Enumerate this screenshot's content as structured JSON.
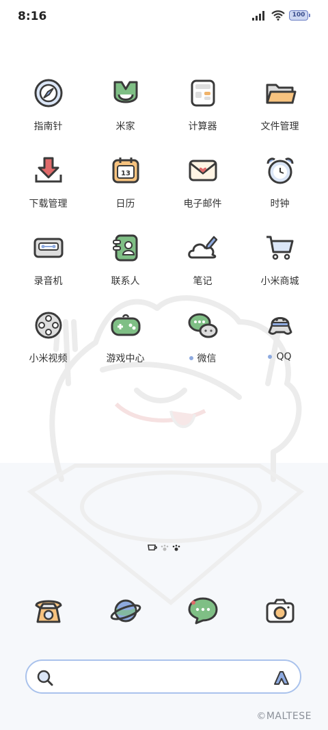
{
  "status_bar": {
    "time": "8:16",
    "battery": "100"
  },
  "apps": [
    {
      "label": "指南针",
      "icon": "compass-icon"
    },
    {
      "label": "米家",
      "icon": "mijia-icon"
    },
    {
      "label": "计算器",
      "icon": "calculator-icon"
    },
    {
      "label": "文件管理",
      "icon": "folder-icon"
    },
    {
      "label": "下载管理",
      "icon": "download-icon"
    },
    {
      "label": "日历",
      "icon": "calendar-icon",
      "day": "13"
    },
    {
      "label": "电子邮件",
      "icon": "mail-icon"
    },
    {
      "label": "时钟",
      "icon": "alarm-clock-icon"
    },
    {
      "label": "录音机",
      "icon": "recorder-icon"
    },
    {
      "label": "联系人",
      "icon": "contacts-icon"
    },
    {
      "label": "笔记",
      "icon": "notes-icon"
    },
    {
      "label": "小米商城",
      "icon": "cart-icon"
    },
    {
      "label": "小米视频",
      "icon": "film-reel-icon"
    },
    {
      "label": "游戏中心",
      "icon": "gamepad-icon"
    },
    {
      "label": "微信",
      "icon": "wechat-icon"
    },
    {
      "label": "QQ",
      "icon": "qq-penguin-icon"
    }
  ],
  "dock": [
    {
      "icon": "phone-icon"
    },
    {
      "icon": "browser-planet-icon"
    },
    {
      "icon": "messages-icon"
    },
    {
      "icon": "camera-icon"
    }
  ],
  "watermark": "©MALTESE",
  "colors": {
    "outline": "#3a3a3a",
    "green": "#7fbf85",
    "blue_accent": "#8eaae0",
    "orange": "#f0b36a",
    "red": "#e06a6a"
  }
}
